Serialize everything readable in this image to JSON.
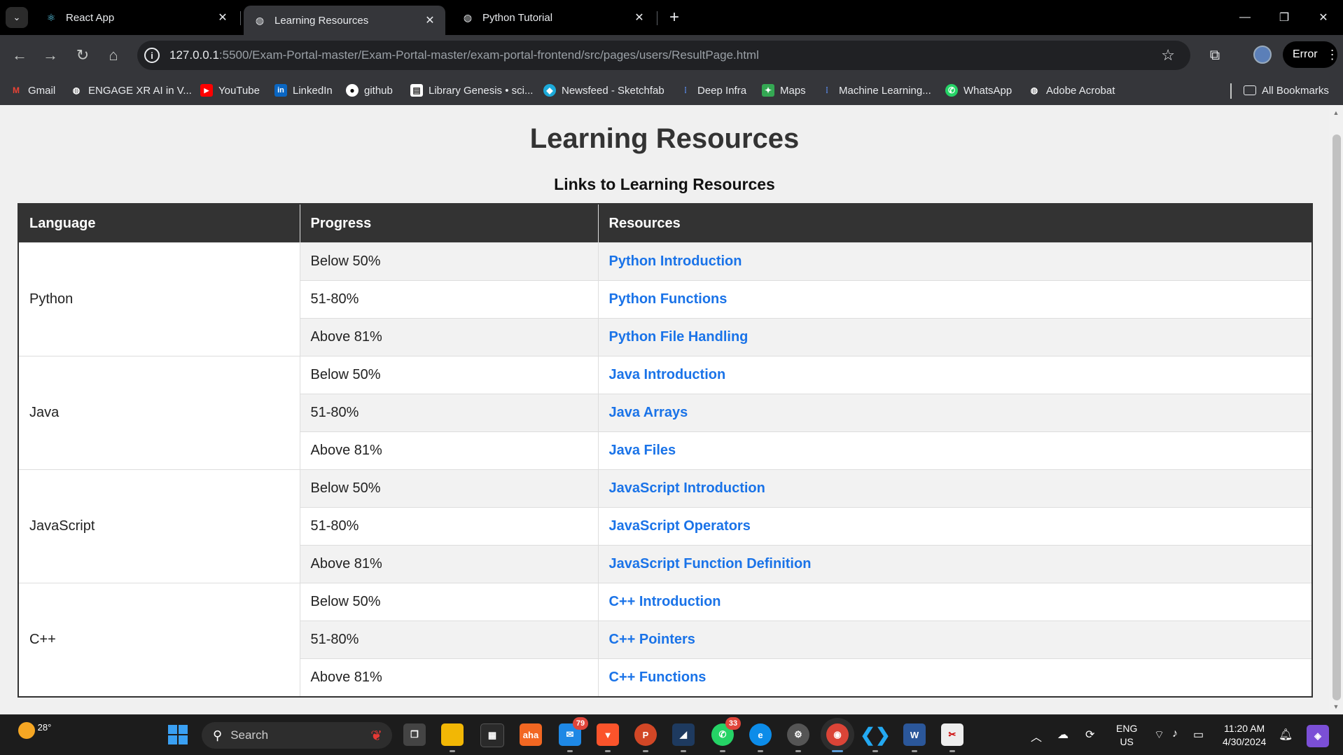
{
  "browser": {
    "tabs": [
      {
        "title": "React App",
        "favicon": "react-icon",
        "active": false
      },
      {
        "title": "Learning Resources",
        "favicon": "globe-icon",
        "active": true
      },
      {
        "title": "Python Tutorial",
        "favicon": "globe-icon",
        "active": false
      }
    ],
    "url_host": "127.0.0.1",
    "url_path": ":5500/Exam-Portal-master/Exam-Portal-master/exam-portal-frontend/src/pages/users/ResultPage.html",
    "profile_status": "Error",
    "bookmarks": [
      {
        "label": "Gmail",
        "icon": "gmail-icon"
      },
      {
        "label": "ENGAGE XR AI in V...",
        "icon": "globe-icon"
      },
      {
        "label": "YouTube",
        "icon": "youtube-icon"
      },
      {
        "label": "LinkedIn",
        "icon": "linkedin-icon"
      },
      {
        "label": "github",
        "icon": "github-icon"
      },
      {
        "label": "Library Genesis • sci...",
        "icon": "library-icon"
      },
      {
        "label": "Newsfeed - Sketchfab",
        "icon": "sketchfab-icon"
      },
      {
        "label": "Deep Infra",
        "icon": "deepinfra-icon"
      },
      {
        "label": "Maps",
        "icon": "maps-icon"
      },
      {
        "label": "Machine Learning...",
        "icon": "ml-icon"
      },
      {
        "label": "WhatsApp",
        "icon": "whatsapp-icon"
      },
      {
        "label": "Adobe Acrobat",
        "icon": "globe-icon"
      }
    ],
    "all_bookmarks": "All Bookmarks"
  },
  "page": {
    "title": "Learning Resources",
    "subtitle": "Links to Learning Resources",
    "table": {
      "headers": [
        "Language",
        "Progress",
        "Resources"
      ],
      "groups": [
        {
          "language": "Python",
          "rows": [
            {
              "progress": "Below 50%",
              "resource": "Python Introduction"
            },
            {
              "progress": "51-80%",
              "resource": "Python Functions"
            },
            {
              "progress": "Above 81%",
              "resource": "Python File Handling"
            }
          ]
        },
        {
          "language": "Java",
          "rows": [
            {
              "progress": "Below 50%",
              "resource": "Java Introduction"
            },
            {
              "progress": "51-80%",
              "resource": "Java Arrays"
            },
            {
              "progress": "Above 81%",
              "resource": "Java Files"
            }
          ]
        },
        {
          "language": "JavaScript",
          "rows": [
            {
              "progress": "Below 50%",
              "resource": "JavaScript Introduction"
            },
            {
              "progress": "51-80%",
              "resource": "JavaScript Operators"
            },
            {
              "progress": "Above 81%",
              "resource": "JavaScript Function Definition"
            }
          ]
        },
        {
          "language": "C++",
          "rows": [
            {
              "progress": "Below 50%",
              "resource": "C++ Introduction"
            },
            {
              "progress": "51-80%",
              "resource": "C++ Pointers"
            },
            {
              "progress": "Above 81%",
              "resource": "C++ Functions"
            }
          ]
        }
      ]
    }
  },
  "taskbar": {
    "weather_temp": "28°",
    "search_placeholder": "Search",
    "badges": {
      "mail": "79",
      "whatsapp": "33"
    },
    "language": "ENG",
    "region": "US",
    "time": "11:20 AM",
    "date": "4/30/2024"
  },
  "colors": {
    "link": "#1a73e8",
    "table_header": "#333333",
    "page_background": "#f0f0f0"
  }
}
